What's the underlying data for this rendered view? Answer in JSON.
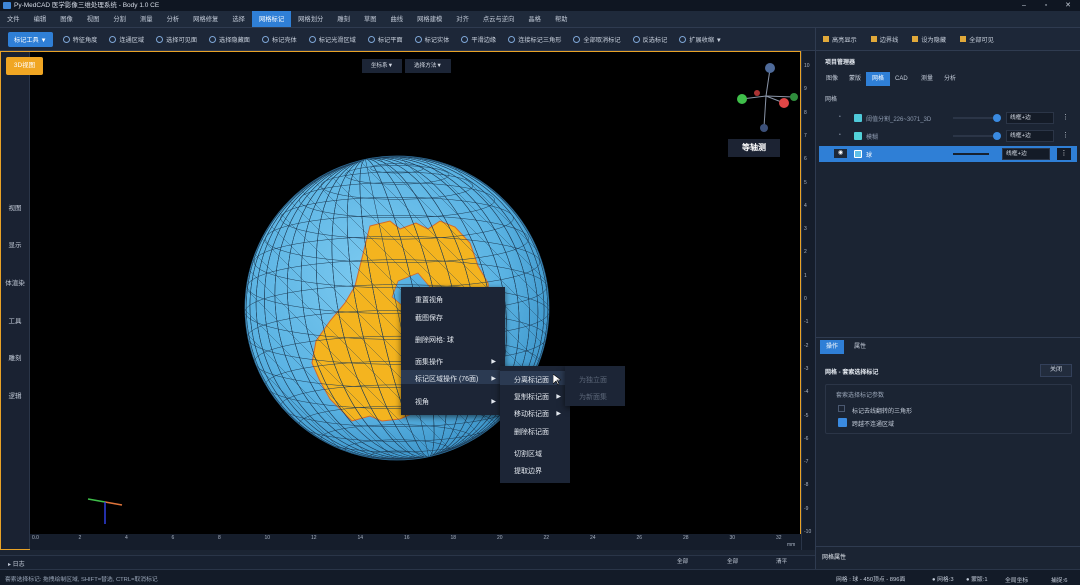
{
  "title": "Py-MedCAD 医学影像三维处理系统 -  Body 1.0 CE",
  "menu": [
    "文件",
    "编辑",
    "图像",
    "视图",
    "分割",
    "测量",
    "分析",
    "网格修复",
    "选择",
    "网格标记",
    "网格划分",
    "雕刻",
    "草图",
    "曲线",
    "网格建模",
    "对齐",
    "点云与逆向",
    "晶格",
    "帮助"
  ],
  "menu_active": "网格标记",
  "toolbar": {
    "primary": "标记工具 ▼",
    "items": [
      "特征角度",
      "连通区域",
      "选择可见面",
      "选择隐藏面",
      "标记壳体",
      "标记光滑区域",
      "标记平面",
      "标记实体",
      "平滑边缘",
      "连接标记三角形",
      "全部取消标记",
      "反选标记",
      "扩展收缩 ▼"
    ]
  },
  "right_toolbar": [
    "高亮显示",
    "边界线",
    "设为隐藏",
    "全部可见"
  ],
  "left_side": [
    "视图",
    "显示",
    "体渲染",
    "工具",
    "雕刻",
    "逻辑"
  ],
  "viewport": {
    "mode_button": "3D视图",
    "coord_button": "坐标系▼",
    "select_button": "选择方法▼",
    "iso_label": "等轴测",
    "unit": "mm",
    "bottom_ticks": [
      "0.0",
      "2",
      "4",
      "6",
      "8",
      "10",
      "12",
      "14",
      "16",
      "18",
      "20",
      "22",
      "24",
      "26",
      "28",
      "30",
      "32"
    ],
    "right_ticks": [
      "10",
      "9",
      "8",
      "7",
      "6",
      "5",
      "4",
      "3",
      "2",
      "1",
      "0",
      "-1",
      "-2",
      "-3",
      "-4",
      "-5",
      "-6",
      "-7",
      "-8",
      "-9",
      "-10"
    ]
  },
  "context_menu": {
    "items": [
      "重置视角",
      "截图保存",
      "删除网格: 球",
      "面集操作",
      "标记区域操作 (76面)",
      "视角"
    ],
    "submenu": [
      "分离标记面",
      "复制标记面",
      "移动标记面",
      "删除标记面",
      "切割区域",
      "提取边界"
    ],
    "subsubmenu": [
      "为独立面",
      "为新面集"
    ]
  },
  "right_panel": {
    "project_title": "项目管理器",
    "tabs": [
      "图像",
      "蒙版",
      "网格",
      "CAD",
      "测量",
      "分析"
    ],
    "active_tab": "网格",
    "section": "网格",
    "rows": [
      {
        "name": "阈值分割_226~3071_3D",
        "color": "#4fc9d9",
        "mode": "线框+边"
      },
      {
        "name": "模糊",
        "color": "#52d1d8",
        "mode": "线框+边"
      },
      {
        "name": "球",
        "color": "#5fc0e8",
        "mode": "线框+边"
      }
    ],
    "op_tabs": [
      "操作",
      "属性"
    ],
    "op_title": "网格 - 套索选择标记",
    "close_btn": "关闭",
    "params_title": "套索选择标记参数",
    "opt1": "标记去线翻转的三角形",
    "opt2": "跨越不连通区域",
    "footer": "网格属性"
  },
  "log": {
    "label": "▸ 日志",
    "cells": [
      "全部",
      "全部",
      "清平"
    ]
  },
  "status": {
    "hint": "套索选择标记: 拖拽绘制区域, SHIFT=替选, CTRL=取消标记",
    "mesh_info": "网格 : 球 - 450顶点 - 896面",
    "grid_count": "● 网格:3",
    "mask_count": "● 蒙版:1",
    "coord": "全局坐标",
    "snap": "捕捉:6"
  },
  "colors": {
    "accent": "#2f7fd6",
    "orange": "#f0a623",
    "sphere": "#58b3e4",
    "marked": "#f4b41f",
    "panel": "#1b2433"
  }
}
